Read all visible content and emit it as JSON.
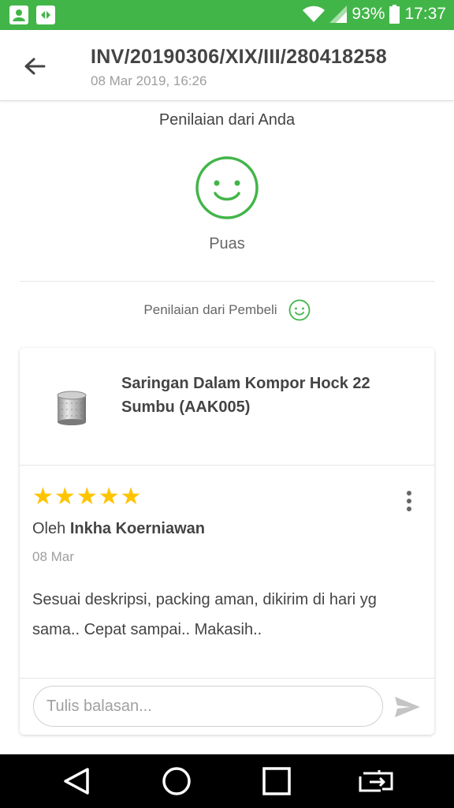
{
  "status_bar": {
    "battery_percent": "93%",
    "time": "17:37"
  },
  "header": {
    "invoice_number": "INV/20190306/XIX/III/280418258",
    "invoice_datetime": "08 Mar 2019, 16:26"
  },
  "your_rating": {
    "title": "Penilaian dari Anda",
    "result_label": "Puas"
  },
  "buyer_rating": {
    "label": "Penilaian dari Pembeli"
  },
  "review": {
    "product_name": "Saringan Dalam Kompor Hock 22 Sumbu (AAK005)",
    "stars": 5,
    "by_prefix": "Oleh",
    "reviewer_name": "Inkha Koerniawan",
    "date": "08 Mar",
    "text": "Sesuai deskripsi, packing aman, dikirim di hari yg sama.. Cepat sampai.. Makasih..",
    "reply_placeholder": "Tulis balasan..."
  },
  "colors": {
    "brand_green": "#42b549",
    "star_yellow": "#ffc400"
  },
  "icons": [
    "back-arrow-icon",
    "smiley-icon",
    "more-vert-icon",
    "send-icon",
    "wifi-icon",
    "signal-icon",
    "battery-icon"
  ]
}
